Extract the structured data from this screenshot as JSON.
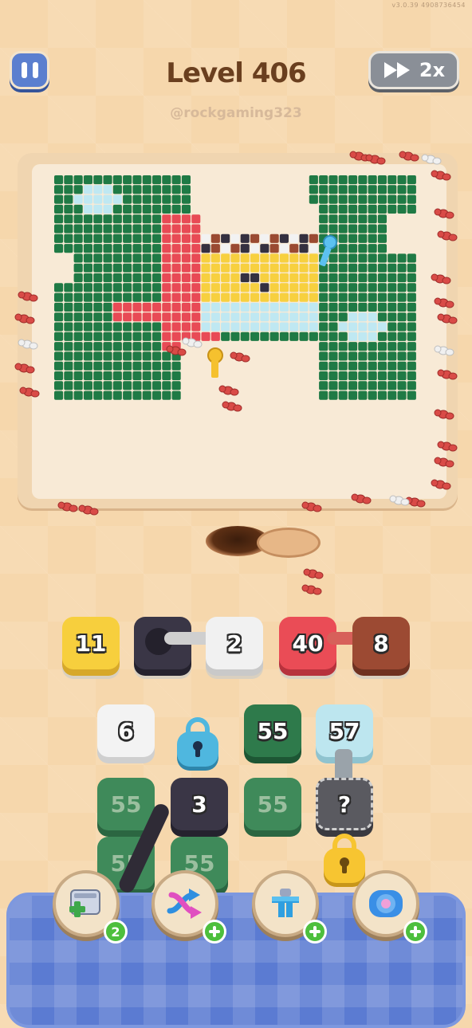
{
  "version_text": "v3.0.39  4908736454",
  "level": {
    "title": "Level 406",
    "subtitle": "@rockgaming323"
  },
  "speed": {
    "label": "2x"
  },
  "colors": {
    "green": "#1f7a45",
    "red": "#e84a55",
    "yellow": "#f7d03f",
    "light_blue": "#bfe8f2",
    "dark": "#343040",
    "brown": "#9a4a32",
    "white": "#f2f2f2"
  },
  "queue": [
    {
      "label": "11",
      "color": "yellow"
    },
    {
      "label": "",
      "color": "dark"
    },
    {
      "label": "2",
      "color": "white"
    },
    {
      "label": "40",
      "color": "red"
    },
    {
      "label": "8",
      "color": "brown"
    }
  ],
  "grid": {
    "row1": [
      "6",
      "",
      "55",
      "57"
    ],
    "row2": [
      "55",
      "3",
      "55",
      "?"
    ],
    "row3": [
      "55",
      "55"
    ]
  },
  "boosters": [
    {
      "icon": "add-slot-icon",
      "badge": "2"
    },
    {
      "icon": "shuffle-arrows-icon",
      "badge": "+"
    },
    {
      "icon": "magnet-claw-icon",
      "badge": "+"
    },
    {
      "icon": "donut-ring-icon",
      "badge": "+"
    }
  ]
}
